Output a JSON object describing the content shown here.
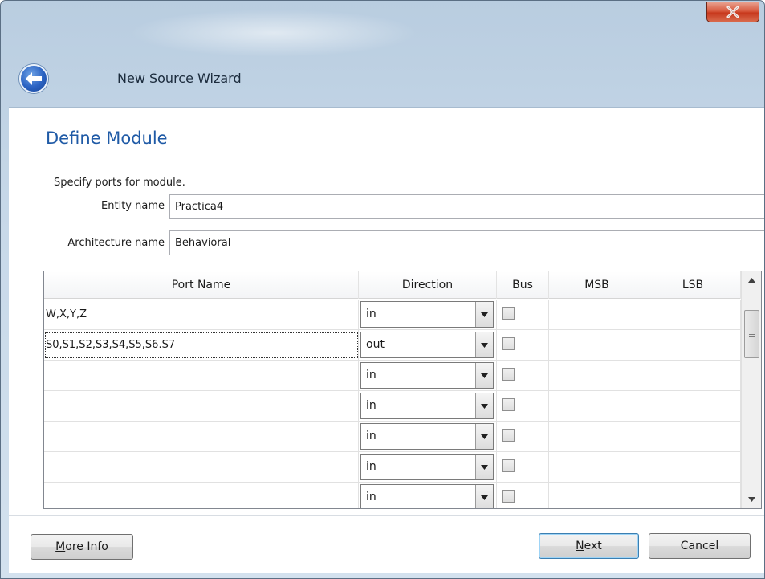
{
  "window": {
    "title": "New Source Wizard",
    "close_glyph": "x",
    "back_icon": "back-arrow-icon"
  },
  "page": {
    "title": "Define Module",
    "instructions": "Specify ports for module."
  },
  "fields": {
    "entity": {
      "label": "Entity name",
      "value": "Practica4"
    },
    "architecture": {
      "label": "Architecture name",
      "value": "Behavioral"
    }
  },
  "grid": {
    "headers": [
      "Port Name",
      "Direction",
      "Bus",
      "MSB",
      "LSB"
    ],
    "rows": [
      {
        "name": "W,X,Y,Z",
        "direction": "in",
        "bus": false,
        "msb": "",
        "lsb": ""
      },
      {
        "name": "S0,S1,S2,S3,S4,S5,S6.S7",
        "direction": "out",
        "bus": false,
        "msb": "",
        "lsb": ""
      },
      {
        "name": "",
        "direction": "in",
        "bus": false,
        "msb": "",
        "lsb": ""
      },
      {
        "name": "",
        "direction": "in",
        "bus": false,
        "msb": "",
        "lsb": ""
      },
      {
        "name": "",
        "direction": "in",
        "bus": false,
        "msb": "",
        "lsb": ""
      },
      {
        "name": "",
        "direction": "in",
        "bus": false,
        "msb": "",
        "lsb": ""
      },
      {
        "name": "",
        "direction": "in",
        "bus": false,
        "msb": "",
        "lsb": ""
      }
    ]
  },
  "buttons": {
    "more_info": {
      "accel": "M",
      "rest": "ore Info"
    },
    "next": {
      "accel": "N",
      "rest": "ext"
    },
    "cancel": "Cancel"
  }
}
